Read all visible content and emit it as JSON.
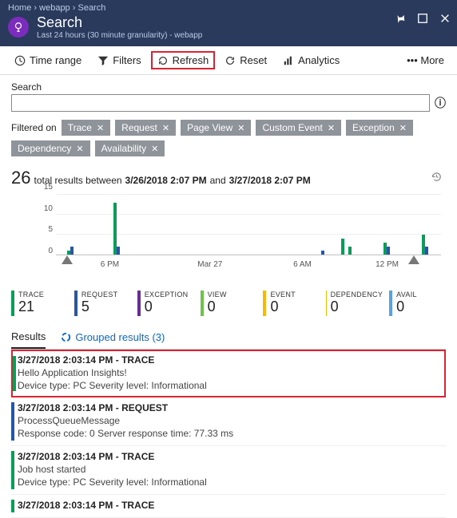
{
  "breadcrumb": {
    "home": "Home",
    "sep": "›",
    "app": "webapp",
    "page": "Search"
  },
  "header": {
    "title": "Search",
    "subtitle": "Last 24 hours (30 minute granularity) - webapp"
  },
  "toolbar": {
    "timerange": "Time range",
    "filters": "Filters",
    "refresh": "Refresh",
    "reset": "Reset",
    "analytics": "Analytics",
    "more": "••• More"
  },
  "search": {
    "label": "Search",
    "value": ""
  },
  "info_tooltip": "Info",
  "filtered_on": "Filtered on",
  "chips": [
    "Trace",
    "Request",
    "Page View",
    "Custom Event",
    "Exception",
    "Dependency",
    "Availability"
  ],
  "summary": {
    "count": "26",
    "text1": "total results between",
    "start": "3/26/2018 2:07 PM",
    "and": "and",
    "end": "3/27/2018 2:07 PM"
  },
  "chart_data": {
    "type": "bar",
    "y_ticks": [
      0,
      5,
      10,
      15
    ],
    "x_ticks": [
      "6 PM",
      "Mar 27",
      "6 AM",
      "12 PM"
    ],
    "bars": [
      {
        "x_pct": 3,
        "green": 1,
        "blue": 2
      },
      {
        "x_pct": 15,
        "green": 13,
        "blue": 2
      },
      {
        "x_pct": 68,
        "green": 0,
        "blue": 1
      },
      {
        "x_pct": 74,
        "green": 4,
        "blue": 0
      },
      {
        "x_pct": 76,
        "green": 2,
        "blue": 0
      },
      {
        "x_pct": 85,
        "green": 3,
        "blue": 2
      },
      {
        "x_pct": 95,
        "green": 5,
        "blue": 2
      }
    ],
    "triangles_pct": [
      3,
      93
    ]
  },
  "stats": [
    {
      "label": "TRACE",
      "value": "21",
      "color": "#0a9d58"
    },
    {
      "label": "REQUEST",
      "value": "5",
      "color": "#2756a5"
    },
    {
      "label": "EXCEPTION",
      "value": "0",
      "color": "#6a2c91"
    },
    {
      "label": "VIEW",
      "value": "0",
      "color": "#6fc24c"
    },
    {
      "label": "EVENT",
      "value": "0",
      "color": "#f2b90f"
    },
    {
      "label": "DEPENDENCY",
      "value": "0",
      "color": "#e6c200"
    },
    {
      "label": "AVAIL",
      "value": "0",
      "color": "#5aa2d8"
    }
  ],
  "tabs": {
    "results": "Results",
    "grouped": "Grouped results (3)"
  },
  "results": [
    {
      "kind": "trace",
      "highlight": true,
      "header": "3/27/2018 2:03:14 PM - TRACE",
      "message": "Hello Application Insights!",
      "meta": "Device type: PC Severity level: Informational"
    },
    {
      "kind": "req",
      "highlight": false,
      "header": "3/27/2018 2:03:14 PM - REQUEST",
      "message": "ProcessQueueMessage",
      "meta": "Response code: 0 Server response time: 77.33 ms"
    },
    {
      "kind": "trace",
      "highlight": false,
      "header": "3/27/2018 2:03:14 PM - TRACE",
      "message": "Job host started",
      "meta": "Device type: PC Severity level: Informational"
    },
    {
      "kind": "trace",
      "highlight": false,
      "header": "3/27/2018 2:03:14 PM - TRACE",
      "message": "",
      "meta": ""
    }
  ]
}
